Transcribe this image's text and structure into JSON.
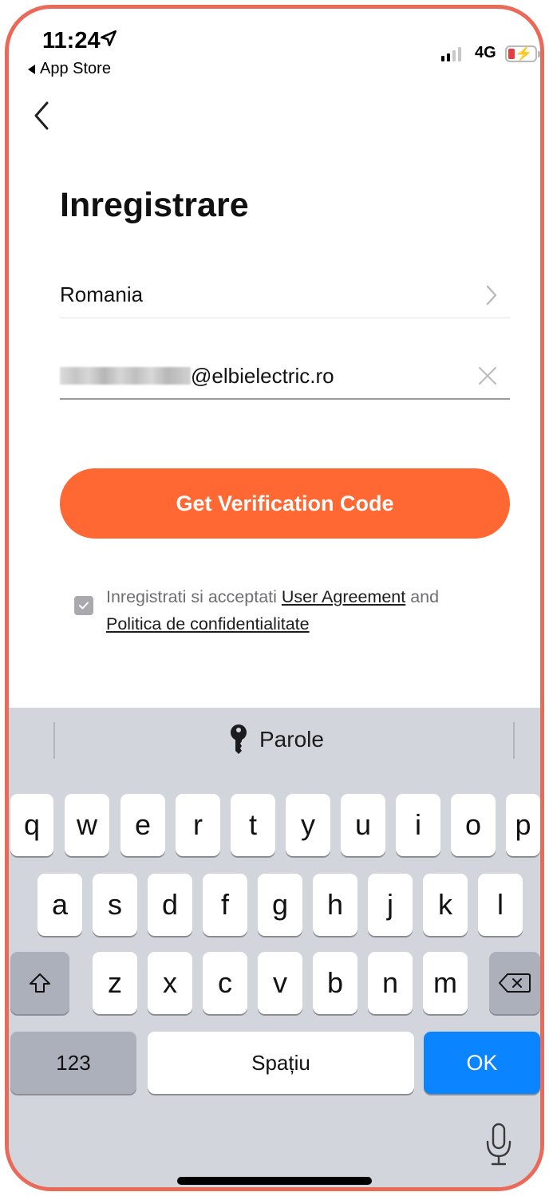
{
  "status_bar": {
    "time": "11:24",
    "back_app": "App Store",
    "network": "4G"
  },
  "page": {
    "title": "Inregistrare",
    "country": "Romania",
    "email_suffix": "@elbielectric.ro",
    "cta": "Get Verification Code",
    "agree_prefix": "Inregistrati si acceptati ",
    "agree_link1": "User Agreement",
    "agree_mid": " and",
    "agree_link2": "Politica de confidentialitate"
  },
  "keyboard": {
    "suggestion": "Parole",
    "row1": [
      "q",
      "w",
      "e",
      "r",
      "t",
      "y",
      "u",
      "i",
      "o",
      "p"
    ],
    "row2": [
      "a",
      "s",
      "d",
      "f",
      "g",
      "h",
      "j",
      "k",
      "l"
    ],
    "row3": [
      "z",
      "x",
      "c",
      "v",
      "b",
      "n",
      "m"
    ],
    "numbers": "123",
    "space": "Spațiu",
    "ok": "OK"
  },
  "colors": {
    "accent": "#ff6833",
    "frame": "#ea6a5a",
    "key_blue": "#0a84ff"
  }
}
